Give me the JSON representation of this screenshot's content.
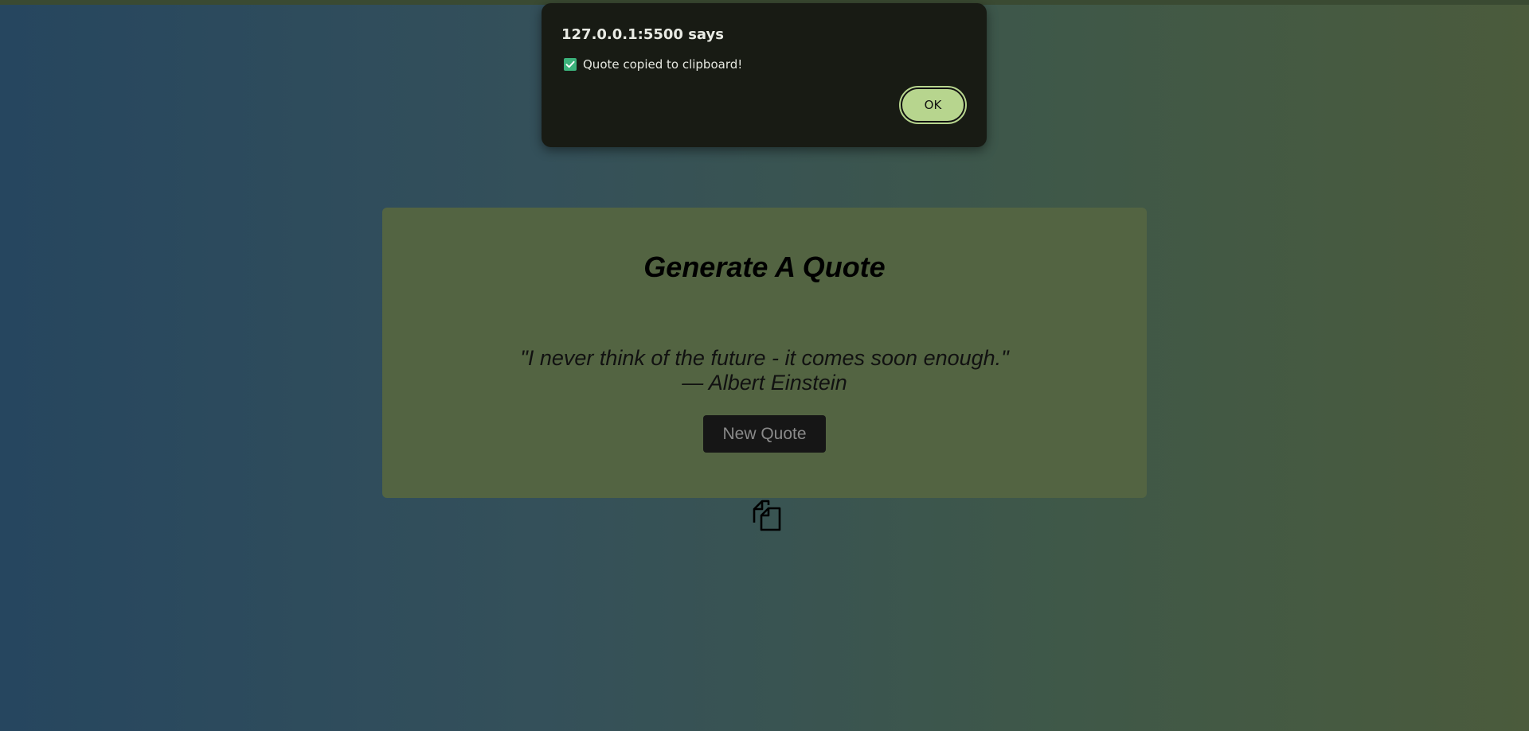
{
  "dialog": {
    "title": "127.0.0.1:5500 says",
    "message": "Quote copied to clipboard!",
    "message_icon": "checkbox-check-icon",
    "ok_label": "OK"
  },
  "card": {
    "title": "Generate A Quote",
    "quote": "\"I never think of the future - it comes soon enough.\"",
    "author": "— Albert Einstein",
    "new_quote_label": "New Quote"
  },
  "copy_button": {
    "icon": "copy-icon"
  },
  "colors": {
    "card_background": "#536442",
    "dialog_background": "#181b14",
    "ok_button": "#b7d58e",
    "new_quote_button": "#161616",
    "check_green": "#3bb27b"
  }
}
